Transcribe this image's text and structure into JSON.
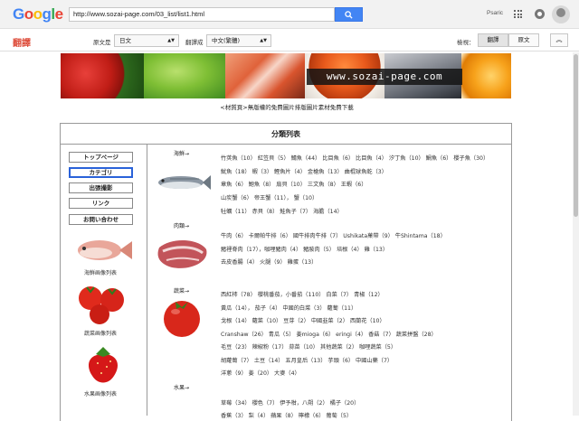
{
  "browser": {
    "logo": [
      "G",
      "o",
      "o",
      "g",
      "l",
      "e"
    ],
    "logo_colors": [
      "#4285f4",
      "#ea4335",
      "#fbbc05",
      "#4285f4",
      "#34a853",
      "#ea4335"
    ],
    "url": "http://www.sozai-page.com/03_list/list1.html",
    "user": "Psaric"
  },
  "translate": {
    "logo": "翻譯",
    "from_label": "原文是",
    "from_value": "日文",
    "to_label": "翻譯成",
    "to_value": "中文(繁體)",
    "view_label": "檢視：",
    "translated_btn": "翻譯",
    "original_btn": "原文"
  },
  "banner": {
    "site_text": "www.sozai-page.com"
  },
  "caption": "<材質頁>無版權的免費圖片排版圖片素材免費下載",
  "panel_title": "分類列表",
  "nav": [
    "トップページ",
    "カテゴリ",
    "出張撮影",
    "リンク",
    "お問い合わせ"
  ],
  "side": [
    "海鮮画像列表",
    "蔬菜画像列表",
    "水果画像列表"
  ],
  "categories": [
    {
      "head": "海鮮→",
      "lines": [
        "竹莢魚（10） 紅笠貝（5） 鯖魚（44） 比目魚（6） 比目魚（4） 汐丁魚（10） 鯛魚（6） 櫻子魚（30）",
        "魷魚（18） 蝦（3） 鰹魚片（4） 金槍魚（13） 曲棍球魚乾（3）",
        "章魚（6） 鮑魚（8） 扇貝（10） 三文魚（8） 王蝦（6）",
        "山炭蟹（6） 帝王蟹（11）， 蟹（10）",
        "牡蠣（11） 赤貝（8） 鮭魚子（7） 海膽（14）"
      ]
    },
    {
      "head": "肉類→",
      "lines": [
        "牛肉（6） 卡爾帕牛排（6） 國牛排肉牛排（7） Ushikata菓帶（9） 牛Shintama（18）",
        "豬裡脊肉（17），咖哩豬肉（4） 豬胺肉（5） 培根（4） 雞（13）",
        "去皮香腸（4） 火腿（9） 雞蛋（13）"
      ]
    },
    {
      "head": "蔬菜→",
      "lines": [
        "西紅柿（78） 櫻桃番茄，小番茄（110） 白菜（7） 青椒（12）",
        "黃瓜（14）， 茄子（4） 中國的白菜（3） 蘿蔔（11）",
        "戈根（14） 蘿菜（10） 豆芽（2） 中國韭菜（2） 西蘭花（10）",
        "Cranshaw（26） 青瓜（5） 姜mioga（6） eringi（4） 香菇（7） 蔬菜拼盤（28）",
        "毛豆（23） 辣椒粉（17） 蒜苗（10） 其他蔬菜（2） 咖哩蔬菜（5）",
        "胡蘿蔔（7） 土豆（14） 五月皇后（13） 芋頭（6） 中國山藥（7）",
        "洋蔥（9） 姜（20） 大麥（4）"
      ]
    },
    {
      "head": "水果→",
      "lines": [
        "草莓（34） 櫻色（7） 伊予柑，八朔（2） 橘子（20）",
        "香蕉（3） 梨（4） 蘋果（8） 檸檬（6） 葡萄（5）"
      ]
    }
  ],
  "colors": {
    "accent": "#2a62d9",
    "google_blue": "#4285f4",
    "translate_red": "#dd4b39"
  }
}
